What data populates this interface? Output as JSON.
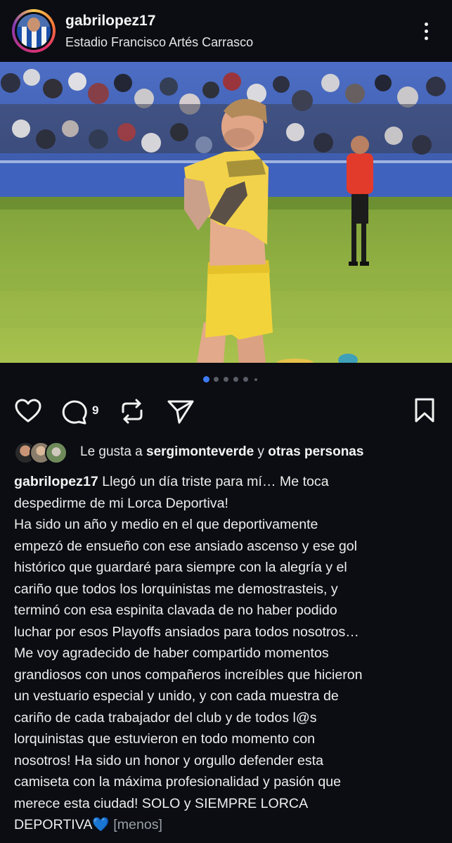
{
  "post": {
    "username": "gabrilopez17",
    "location": "Estadio Francisco Artés Carrasco",
    "carousel": {
      "total_slides": 6,
      "active_index": 0
    },
    "comment_count": "9"
  },
  "likes": {
    "prefix": "Le gusta a ",
    "user": "sergimonteverde",
    "joiner": " y ",
    "others": "otras personas"
  },
  "caption": {
    "username": "gabrilopez17",
    "lines": [
      "Llegó un día triste para mí… Me toca",
      "despedirme de mi Lorca Deportiva!",
      "Ha sido un año y medio en el que deportivamente",
      "empezó de ensueño con ese ansiado ascenso y ese gol",
      "histórico que guardaré para siempre con la alegría y el",
      "cariño que todos los lorquinistas me demostrasteis, y",
      "terminó con esa espinita clavada de no haber podido",
      "luchar por esos Playoffs ansiados para todos nosotros…",
      "Me voy agradecido de haber compartido momentos",
      "grandiosos con unos compañeros increíbles que hicieron",
      "un vestuario especial y unido, y con cada muestra de",
      "cariño de cada trabajador del club y de todos l@s",
      "lorquinistas que estuvieron en todo momento con",
      "nosotros! Ha sido un honor y orgullo defender esta",
      "camiseta con la máxima profesionalidad y pasión que",
      "merece esta ciudad! SOLO y SIEMPRE LORCA",
      "DEPORTIVA💙"
    ],
    "less_label": "[menos]"
  },
  "colors": {
    "background": "#0b0d12",
    "active_dot": "#3f7bf6",
    "inactive_dot": "#5a5e66",
    "text": "#f2f2f2"
  },
  "icons": [
    "more-vertical-icon",
    "heart-icon",
    "comment-icon",
    "repost-icon",
    "send-icon",
    "bookmark-icon"
  ]
}
